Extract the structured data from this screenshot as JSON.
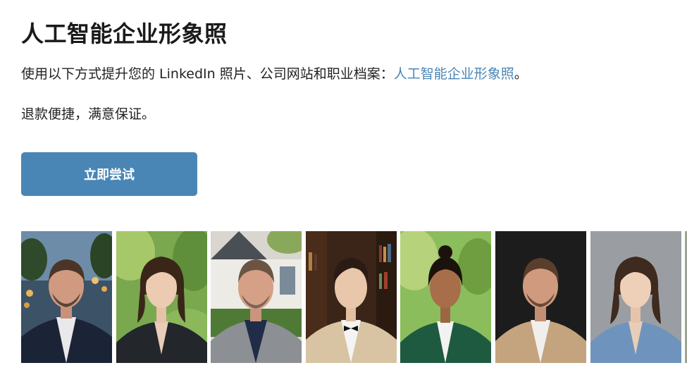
{
  "header": {
    "title": "人工智能企业形象照"
  },
  "intro": {
    "text_before": "使用以下方式提升您的 LinkedIn 照片、公司网站和职业档案：",
    "link_text": "人工智能企业形象照",
    "text_after": "。"
  },
  "refund_note": "退款便捷，满意保证。",
  "cta": {
    "label": "立即尝试"
  },
  "colors": {
    "accent": "#4a86b5",
    "text": "#222222"
  },
  "gallery": {
    "photos": [
      {
        "subject": "man in dark suit with city lights background"
      },
      {
        "subject": "woman in black blazer with green park background"
      },
      {
        "subject": "man in grey blazer with house background"
      },
      {
        "subject": "man in beige tuxedo jacket with bookshelf background"
      },
      {
        "subject": "woman in green blazer with garden background"
      },
      {
        "subject": "man in tan blazer with dark background"
      },
      {
        "subject": "woman in light blue blazer with grey background"
      }
    ]
  }
}
